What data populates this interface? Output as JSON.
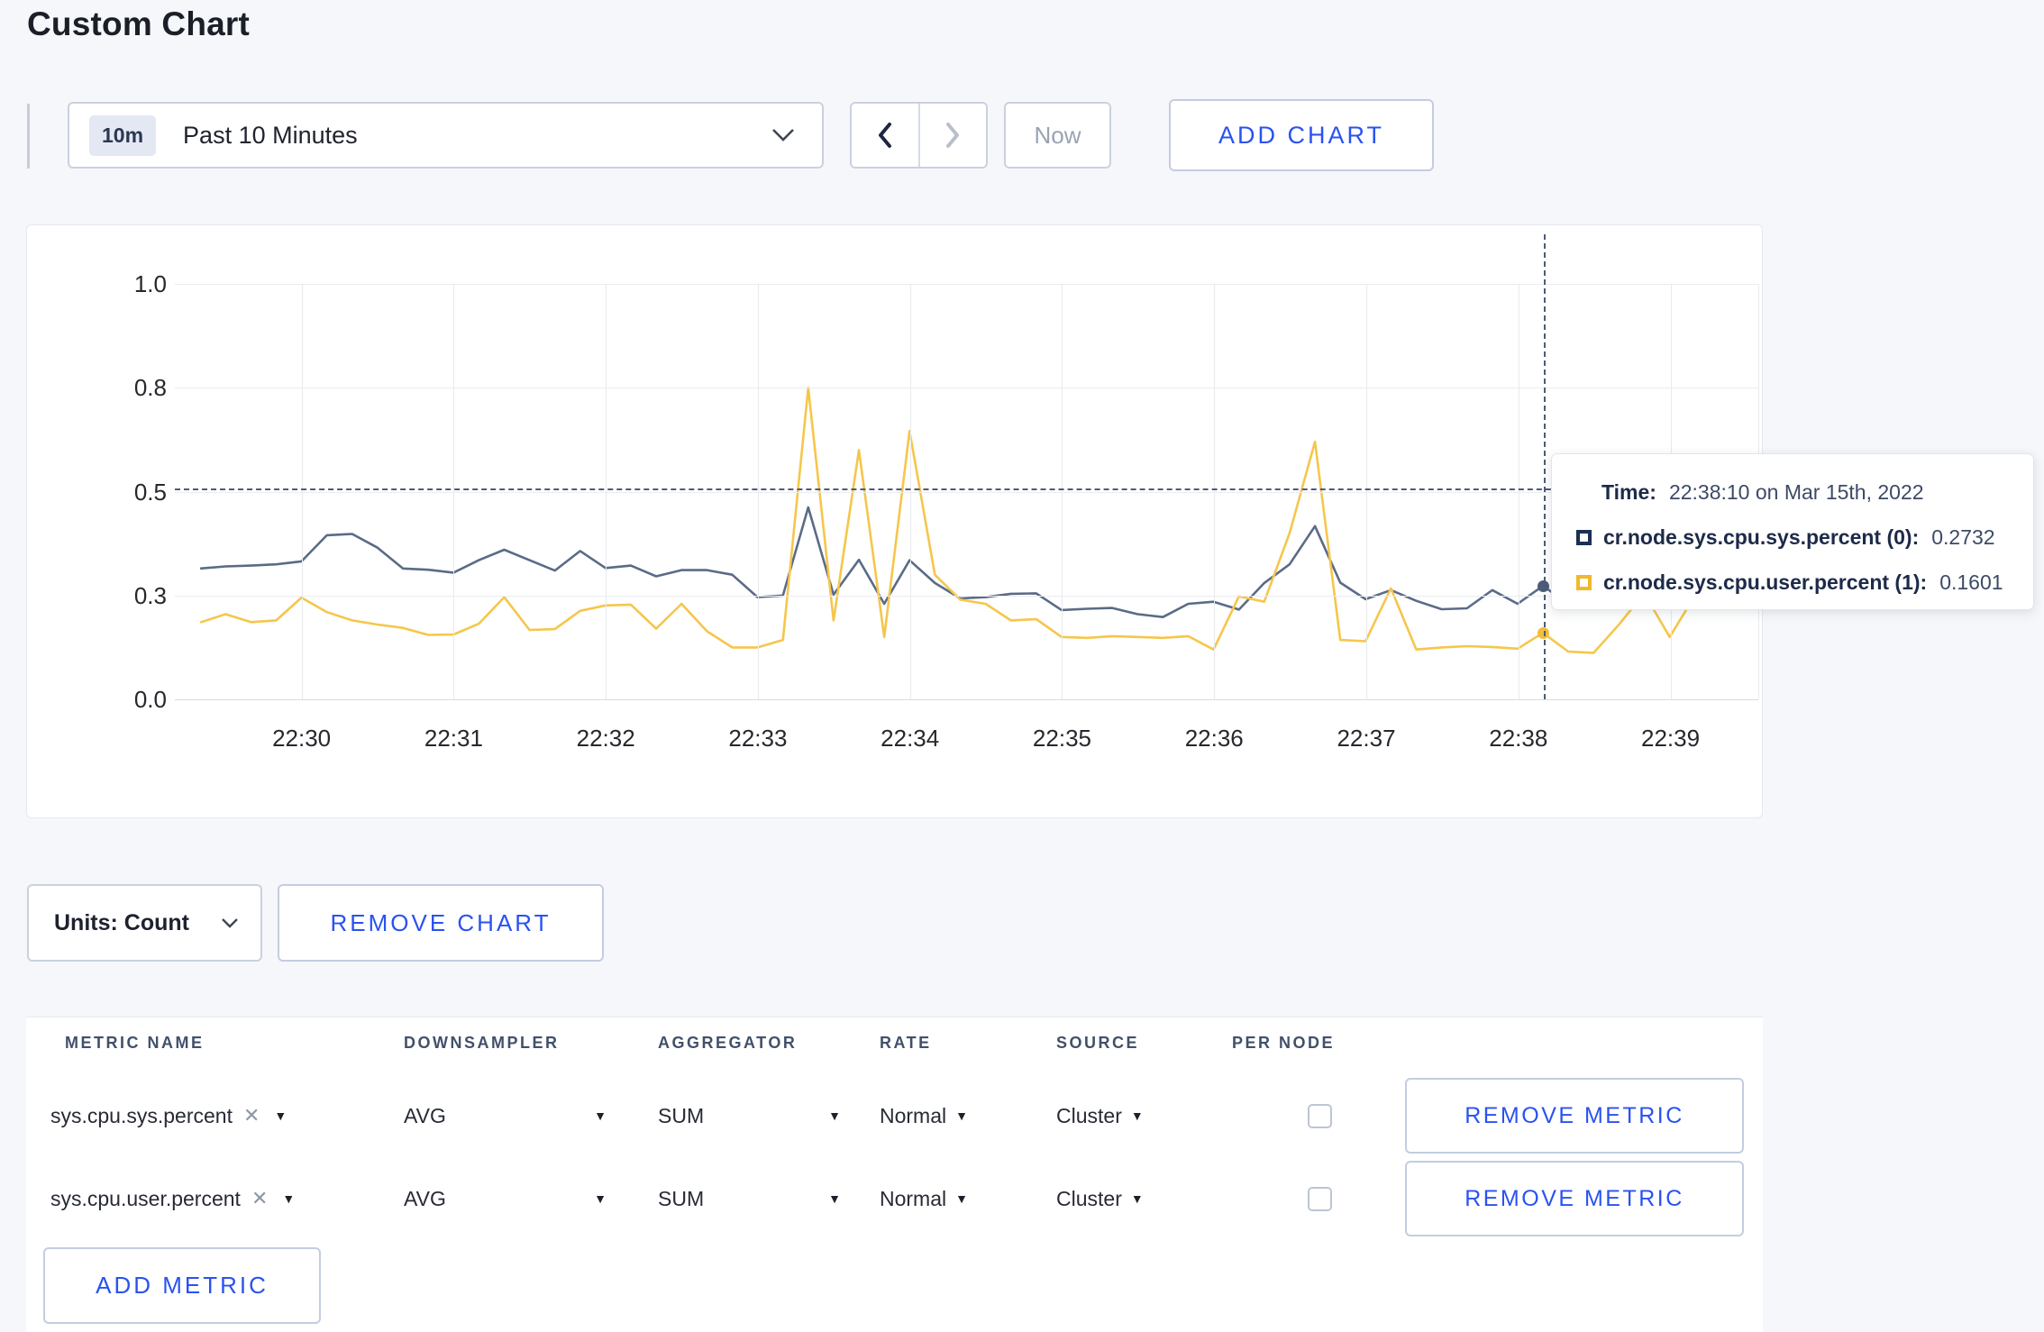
{
  "page_title": "Custom Chart",
  "toolbar": {
    "time_range_badge": "10m",
    "time_range_label": "Past 10 Minutes",
    "now_label": "Now",
    "add_chart_label": "ADD CHART"
  },
  "chart_data": {
    "type": "line",
    "title": "",
    "xlabel": "",
    "ylabel": "",
    "ylim": [
      0,
      1
    ],
    "grid": true,
    "legend_position": "none",
    "x_domain": [
      "22:29:10",
      "22:39:35"
    ],
    "y_ticks": [
      {
        "value": 0,
        "label": "0.0"
      },
      {
        "value": 0.25,
        "label": "0.3"
      },
      {
        "value": 0.5,
        "label": "0.5"
      },
      {
        "value": 0.75,
        "label": "0.8"
      },
      {
        "value": 1,
        "label": "1.0"
      }
    ],
    "x_ticks": [
      "22:30",
      "22:31",
      "22:32",
      "22:33",
      "22:34",
      "22:35",
      "22:36",
      "22:37",
      "22:38",
      "22:39"
    ],
    "x": [
      "22:29:20",
      "22:29:30",
      "22:29:40",
      "22:29:50",
      "22:30:00",
      "22:30:10",
      "22:30:20",
      "22:30:30",
      "22:30:40",
      "22:30:50",
      "22:31:00",
      "22:31:10",
      "22:31:20",
      "22:31:30",
      "22:31:40",
      "22:31:50",
      "22:32:00",
      "22:32:10",
      "22:32:20",
      "22:32:30",
      "22:32:40",
      "22:32:50",
      "22:33:00",
      "22:33:10",
      "22:33:20",
      "22:33:30",
      "22:33:40",
      "22:33:50",
      "22:34:00",
      "22:34:10",
      "22:34:20",
      "22:34:30",
      "22:34:40",
      "22:34:50",
      "22:35:00",
      "22:35:10",
      "22:35:20",
      "22:35:30",
      "22:35:40",
      "22:35:50",
      "22:36:00",
      "22:36:10",
      "22:36:20",
      "22:36:30",
      "22:36:40",
      "22:36:50",
      "22:37:00",
      "22:37:10",
      "22:37:20",
      "22:37:30",
      "22:37:40",
      "22:37:50",
      "22:38:00",
      "22:38:10",
      "22:38:20",
      "22:38:30",
      "22:38:40",
      "22:38:50",
      "22:39:00",
      "22:39:10"
    ],
    "series": [
      {
        "name": "cr.node.sys.cpu.sys.percent",
        "color": "#5a6b87",
        "values": [
          0.315,
          0.32,
          0.322,
          0.325,
          0.332,
          0.395,
          0.398,
          0.365,
          0.315,
          0.312,
          0.305,
          0.335,
          0.36,
          0.335,
          0.31,
          0.357,
          0.316,
          0.322,
          0.296,
          0.311,
          0.311,
          0.3,
          0.246,
          0.25,
          0.462,
          0.252,
          0.336,
          0.23,
          0.335,
          0.28,
          0.243,
          0.246,
          0.254,
          0.255,
          0.215,
          0.218,
          0.22,
          0.205,
          0.198,
          0.23,
          0.235,
          0.216,
          0.28,
          0.325,
          0.417,
          0.281,
          0.241,
          0.263,
          0.237,
          0.217,
          0.219,
          0.263,
          0.23,
          0.2732,
          0.23,
          0.265,
          0.285,
          0.295,
          0.3,
          0.305
        ]
      },
      {
        "name": "cr.node.sys.cpu.user.percent",
        "color": "#f6c64b",
        "values": [
          0.185,
          0.205,
          0.186,
          0.19,
          0.245,
          0.21,
          0.19,
          0.18,
          0.172,
          0.155,
          0.156,
          0.182,
          0.246,
          0.167,
          0.169,
          0.213,
          0.226,
          0.228,
          0.17,
          0.23,
          0.164,
          0.125,
          0.125,
          0.143,
          0.75,
          0.19,
          0.6,
          0.15,
          0.646,
          0.3,
          0.24,
          0.23,
          0.19,
          0.193,
          0.15,
          0.148,
          0.152,
          0.15,
          0.148,
          0.152,
          0.12,
          0.248,
          0.235,
          0.4,
          0.62,
          0.143,
          0.14,
          0.267,
          0.12,
          0.125,
          0.128,
          0.126,
          0.122,
          0.1601,
          0.115,
          0.112,
          0.18,
          0.255,
          0.15,
          0.25
        ]
      }
    ],
    "crosshair": {
      "time": "22:38:10",
      "h_value": 0.508,
      "color": "#4d5c79"
    },
    "markers": [
      {
        "time": "22:38:10",
        "value": 0.2732,
        "color": "#4d5c79"
      },
      {
        "time": "22:38:10",
        "value": 0.1601,
        "color": "#f2bd37"
      }
    ]
  },
  "tooltip": {
    "time_label": "Time:",
    "time_value": "22:38:10 on Mar 15th, 2022",
    "entries": [
      {
        "label": "cr.node.sys.cpu.sys.percent (0):",
        "value": "0.2732",
        "color": "#1c2f55"
      },
      {
        "label": "cr.node.sys.cpu.user.percent (1):",
        "value": "0.1601",
        "color": "#f0b929"
      }
    ]
  },
  "chart_footer": {
    "units_label": "Units: Count",
    "remove_chart_label": "REMOVE CHART"
  },
  "icons": {
    "clear_glyph": "✕",
    "caret_glyph": "▼"
  },
  "metrics_table": {
    "headers": [
      "METRIC NAME",
      "DOWNSAMPLER",
      "AGGREGATOR",
      "RATE",
      "SOURCE",
      "PER NODE"
    ],
    "rows": [
      {
        "metric": "sys.cpu.sys.percent",
        "downsampler": "AVG",
        "aggregator": "SUM",
        "rate": "Normal",
        "source": "Cluster",
        "per_node_checked": false,
        "remove_label": "REMOVE METRIC"
      },
      {
        "metric": "sys.cpu.user.percent",
        "downsampler": "AVG",
        "aggregator": "SUM",
        "rate": "Normal",
        "source": "Cluster",
        "per_node_checked": false,
        "remove_label": "REMOVE METRIC"
      }
    ],
    "add_metric_label": "ADD METRIC"
  },
  "colors": {
    "accent_blue": "#2a52f0",
    "series_sys": "#5a6b87",
    "series_user": "#f6c64b",
    "page_bg": "#f6f7fa"
  }
}
